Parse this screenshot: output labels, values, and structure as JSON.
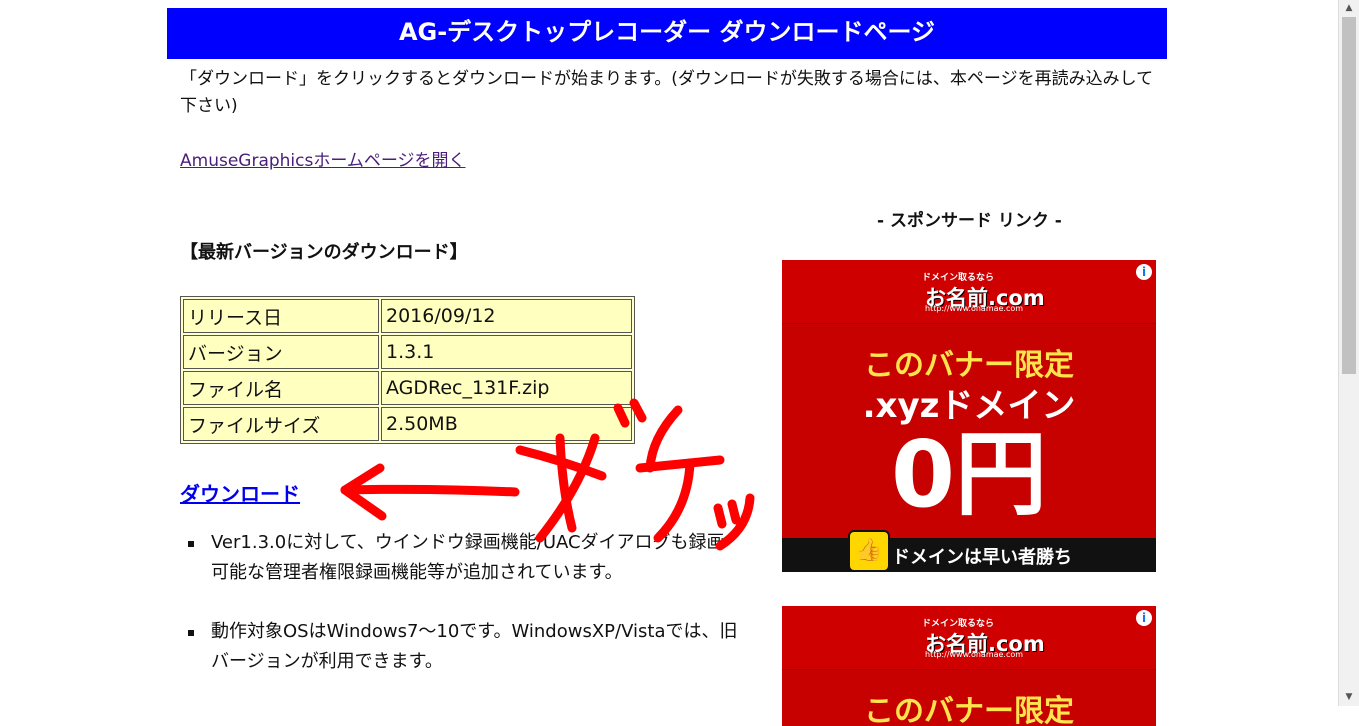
{
  "header": {
    "title": "AG-デスクトップレコーダー ダウンロードページ"
  },
  "intro": "「ダウンロード」をクリックするとダウンロードが始まります。(ダウンロードが失敗する場合には、本ページを再読み込みして下さい)",
  "home_link": "AmuseGraphicsホームページを開く",
  "section_title": "【最新バージョンのダウンロード】",
  "info_table": [
    {
      "key": "リリース日",
      "value": "2016/09/12"
    },
    {
      "key": "バージョン",
      "value": "1.3.1"
    },
    {
      "key": "ファイル名",
      "value": "AGDRec_131F.zip"
    },
    {
      "key": "ファイルサイズ",
      "value": "2.50MB"
    }
  ],
  "download_link": "ダウンロード",
  "notes": [
    "Ver1.3.0に対して、ウインドウ録画機能/UACダイアログも録画可能な管理者権限録画機能等が追加されています。",
    "動作対象OSはWindows7〜10です。WindowsXP/Vistaでは、旧バージョンが利用できます。"
  ],
  "annotation_text": "←ポチッ",
  "sponsor": {
    "title": "- スポンサード リンク -",
    "ad": {
      "tagline": "ドメイン取るなら",
      "brand": "お名前.com",
      "url": "http://www.onamae.com",
      "line1": "このバナー限定",
      "line2": ".xyzドメイン",
      "price": "0円",
      "bottom": "ドメインは早い者勝ち",
      "info": "i"
    }
  },
  "colors": {
    "header_bg": "#0000ff",
    "table_bg": "#ffffc0",
    "ad_red": "#c70000",
    "annotation": "#ff0000"
  },
  "icons": {
    "ad_info": "info-icon",
    "thumb": "thumbs-up-icon",
    "bullet": "square-bullet-icon"
  }
}
